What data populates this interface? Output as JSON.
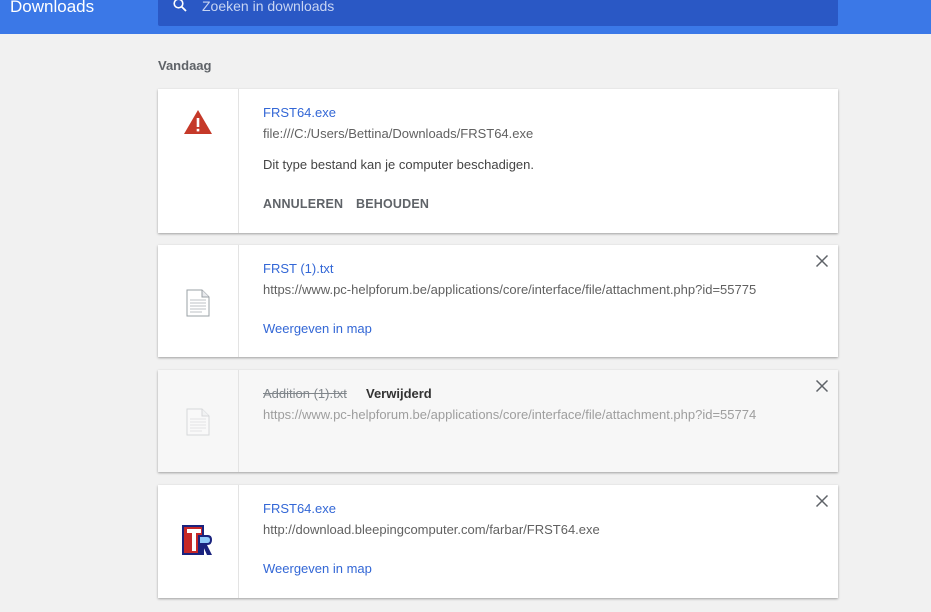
{
  "header": {
    "title": "Downloads",
    "search_placeholder": "Zoeken in downloads",
    "search_value": ""
  },
  "section_label": "Vandaag",
  "downloads": [
    {
      "file_name": "FRST64.exe",
      "url": "file:///C:/Users/Bettina/Downloads/FRST64.exe",
      "warning": "Dit type bestand kan je computer beschadigen.",
      "cancel_label": "ANNULEREN",
      "keep_label": "BEHOUDEN",
      "icon": "warning-icon"
    },
    {
      "file_name": "FRST (1).txt",
      "url": "https://www.pc-helpforum.be/applications/core/interface/file/attachment.php?id=55775",
      "show_in_folder": "Weergeven in map",
      "icon": "text-file-icon"
    },
    {
      "file_name": "Addition (1).txt",
      "status": "Verwijderd",
      "url": "https://www.pc-helpforum.be/applications/core/interface/file/attachment.php?id=55774",
      "icon": "text-file-icon"
    },
    {
      "file_name": "FRST64.exe",
      "url": "http://download.bleepingcomputer.com/farbar/FRST64.exe",
      "show_in_folder": "Weergeven in map",
      "icon": "frst-app-icon"
    }
  ],
  "colors": {
    "header_bg": "#3b78e7",
    "search_bg": "#2a58c5",
    "link": "#3367d6",
    "warning": "#c53929"
  }
}
